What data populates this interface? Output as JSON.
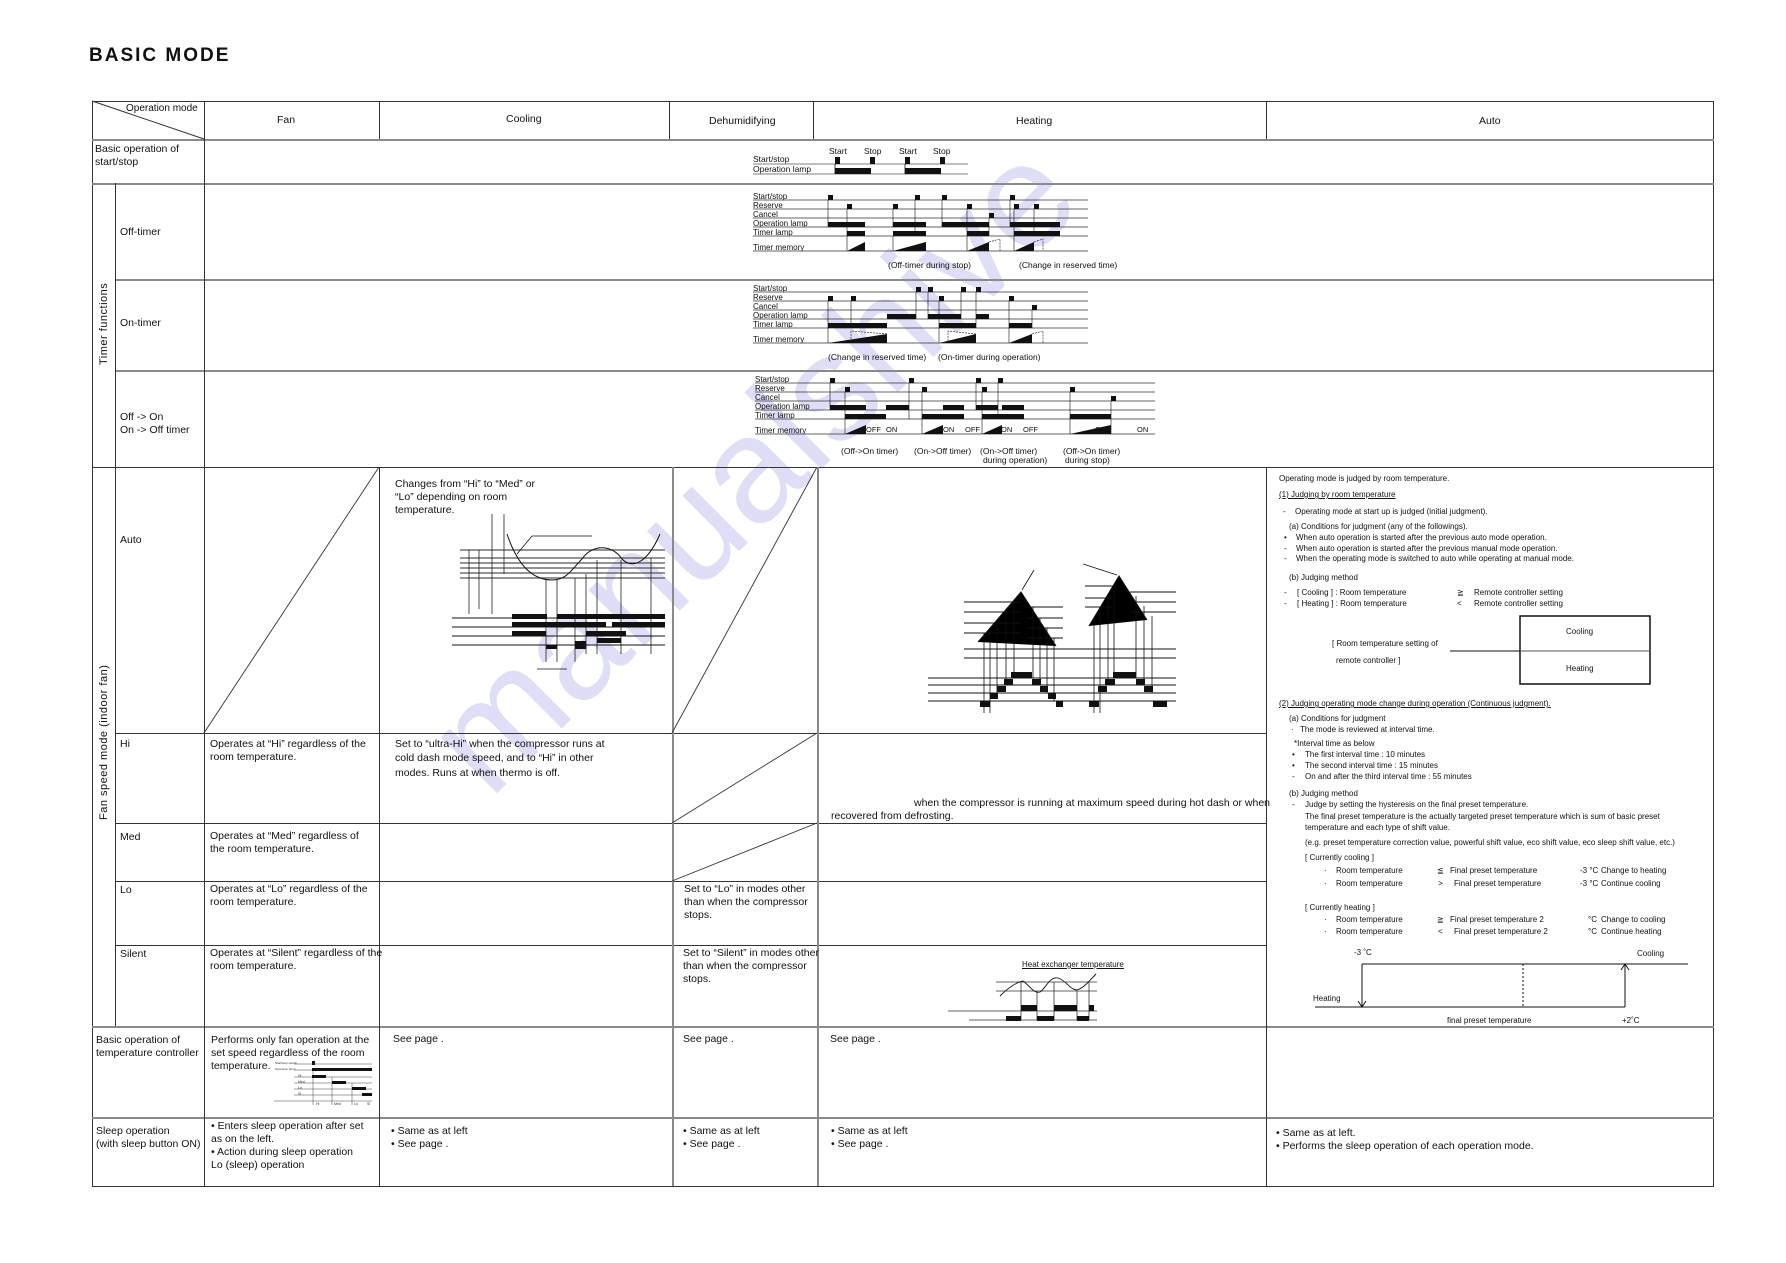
{
  "title": "BASIC MODE",
  "header": {
    "corner_label": "Operation mode",
    "columns": [
      "Fan",
      "Cooling",
      "Dehumidifying",
      "Heating",
      "Auto"
    ]
  },
  "rows": {
    "basic_start_stop": {
      "label": "Basic operation of start/stop",
      "label_lines": [
        "Basic operation of",
        "start/stop"
      ],
      "diagram": {
        "signals": [
          "Start/stop",
          "Operation lamp"
        ],
        "events": [
          "Start",
          "Stop",
          "Start",
          "Stop"
        ]
      }
    },
    "timer_group_label": "Timer functions",
    "off_timer": {
      "label": "Off-timer",
      "diagram": {
        "signals": [
          "Start/stop",
          "Reserve",
          "Cancel",
          "Operation lamp",
          "Timer lamp",
          "Timer memory"
        ],
        "captions": [
          "(Off-timer during stop)",
          "(Change in reserved time)"
        ]
      }
    },
    "on_timer": {
      "label": "On-timer",
      "diagram": {
        "signals": [
          "Start/stop",
          "Reserve",
          "Cancel",
          "Operation lamp",
          "Timer lamp",
          "Timer memory"
        ],
        "captions": [
          "(Change in reserved time)",
          "(On-timer during operation)"
        ]
      }
    },
    "off_on_timer": {
      "label_lines": [
        "Off  -> On",
        "On  -> Off timer"
      ],
      "diagram": {
        "signals": [
          "Start/stop",
          "Reserve",
          "Cancel",
          "Operation lamp",
          "Timer lamp",
          "Timer memory"
        ],
        "memory_tags": [
          "OFF",
          "ON",
          "ON",
          "OFF",
          "ON",
          "OFF",
          "OFF",
          "ON"
        ],
        "captions": [
          [
            "(Off->On timer)"
          ],
          [
            "(On->Off timer)"
          ],
          [
            "(On->Off timer)",
            "during operation)"
          ],
          [
            "(Off->On timer)",
            "during stop)"
          ]
        ]
      }
    },
    "fan_group_label": "Fan speed mode (indoor fan)",
    "auto": {
      "label": "Auto",
      "cooling_text": [
        "Changes from “Hi” to “Med” or",
        "“Lo” depending on room",
        "temperature."
      ]
    },
    "hi": {
      "label": "Hi",
      "fan_text": [
        "Operates at “Hi” regardless of the",
        "room temperature."
      ],
      "cooling_text": [
        "Set to “ultra-Hi” when the  compressor runs at",
        "cold dash  mode speed, and to “Hi” in other",
        "modes. Runs at                when  thermo is off."
      ],
      "heating_text": [
        "when the compressor is running at maximum speed during hot dash or when",
        "recovered from defrosting."
      ]
    },
    "med": {
      "label": "Med",
      "fan_text": [
        "Operates at “Med” regardless of",
        "the room temperature."
      ]
    },
    "lo": {
      "label": "Lo",
      "fan_text": [
        "Operates at “Lo” regardless of the",
        "room temperature."
      ],
      "dehumidifying_text": [
        "Set to “Lo” in modes other",
        "than  when the  compressor",
        "stops."
      ]
    },
    "silent": {
      "label": "Silent",
      "fan_text": [
        "Operates at “Silent” regardless of the",
        "room temperature."
      ],
      "dehumidifying_text": [
        "Set to “Silent” in modes other",
        "than  when the  compressor",
        "stops."
      ],
      "heating_diagram_label": "Heat exchanger temperature"
    },
    "temp_controller": {
      "label_lines": [
        "Basic operation of",
        "temperature controller"
      ],
      "fan_text": [
        "Performs only fan operation at the",
        "set speed regardless of the room",
        "temperature."
      ],
      "fan_diagram": {
        "signals": [
          "Start/stop switch",
          "Operation lamp",
          "Hi",
          "Med",
          "Lo",
          "Sl"
        ],
        "axis_label": "Fan speed",
        "bottom": [
          "Hi",
          "Med",
          "Lo",
          "Sl"
        ]
      },
      "cooling_text": "See page    .",
      "dehumidifying_text": "See page    .",
      "heating_text": "See page    ."
    },
    "sleep": {
      "label_lines": [
        "Sleep operation",
        "(with sleep button ON)"
      ],
      "fan_text": [
        "• Enters sleep operation after set",
        "   as on the left.",
        "• Action during sleep operation",
        "   Lo (sleep) operation"
      ],
      "cooling_text": [
        "• Same as at left",
        "• See page    ."
      ],
      "dehumidifying_text": [
        "• Same as at left",
        "• See page    ."
      ],
      "heating_text": [
        "• Same as at left",
        "• See page    ."
      ],
      "auto_text": [
        "• Same as at left.",
        "• Performs the sleep operation of each operation mode."
      ]
    }
  },
  "auto_column": {
    "intro": "Operating mode is judged by room temperature.",
    "s1_title": "(1) Judging by room temperature",
    "s1_bullet": "Operating mode at start up is judged (initial judgment).",
    "s1a_title": "(a) Conditions for judgment (any of the followings).",
    "s1a_items": [
      "When auto operation is started after the previous auto mode operation.",
      "When auto operation is started after the previous manual mode operation.",
      "When the operating mode is switched to auto while operating at manual mode."
    ],
    "s1b_title": "(b) Judging method",
    "s1b_items": [
      {
        "mode": "[ Cooling ] : Room temperature",
        "op": "≧",
        "ref": "Remote controller setting"
      },
      {
        "mode": "[ Heating ] : Room temperature",
        "op": "<",
        "ref": "Remote controller setting"
      }
    ],
    "box_label_lines": [
      "[ Room temperature setting of",
      "remote controller ]"
    ],
    "box_top": "Cooling",
    "box_bottom": "Heating",
    "s2_title": "(2) Judging operating mode change during operation (Continuous judgment).",
    "s2a_title": "(a) Conditions for judgment",
    "s2a_bullet": "The mode is reviewed at interval time.",
    "s2a_note": "*Interval time as below",
    "s2a_items": [
      "The first interval time : 10 minutes",
      "The second interval time : 15 minutes",
      "On and after the third interval time : 55 minutes"
    ],
    "s2b_title": "(b) Judging method",
    "s2b_bullet": "Judge by setting the hysteresis on the final preset temperature.",
    "s2b_desc": [
      "The final preset temperature is the actually targeted preset temperature which is sum of basic preset",
      "temperature and each type of shift value."
    ],
    "s2b_eg": "(e.g. preset temperature correction value, powerful shift value, eco shift value, eco sleep shift value, etc.)",
    "cooling_title": "[ Currently cooling ]",
    "cooling_rules": [
      {
        "lhs": "Room temperature",
        "op": "≦",
        "rhs": "Final preset temperature",
        "offset": "-3 °C",
        "result": "Change to heating"
      },
      {
        "lhs": "Room temperature",
        "op": ">",
        "rhs": "Final preset temperature",
        "offset": "-3 °C",
        "result": "Continue cooling"
      }
    ],
    "heating_title": "[ Currently heating ]",
    "heating_rules": [
      {
        "lhs": "Room temperature",
        "op": "≧",
        "rhs": "Final preset temperature 2",
        "offset": "°C",
        "result": "Change to cooling"
      },
      {
        "lhs": "Room temperature",
        "op": "<",
        "rhs": "Final preset temperature 2",
        "offset": "°C",
        "result": "Continue heating"
      }
    ],
    "hyst": {
      "left_label": "-3 ˚C",
      "right_label": "Cooling",
      "heating_label": "Heating",
      "center_label": "final preset temperature",
      "right_bottom_label": "+2˚C"
    }
  },
  "watermark": "manualshive"
}
